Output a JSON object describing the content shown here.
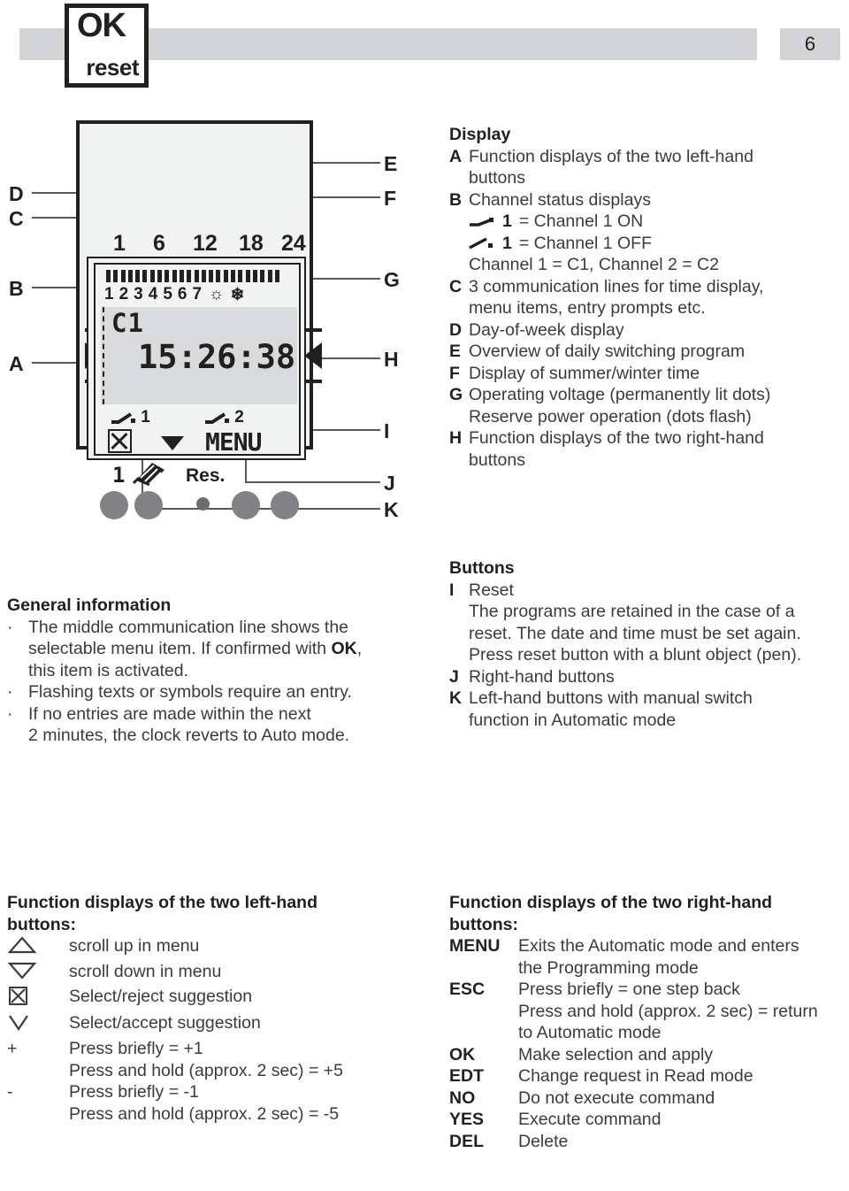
{
  "page": {
    "number": "6"
  },
  "header": {
    "button_box": {
      "ok_label": "OK",
      "reset_label": "reset"
    }
  },
  "device": {
    "hour_scale": [
      "1",
      "6",
      "12",
      "18",
      "24"
    ],
    "day_numbers": [
      "1",
      "2",
      "3",
      "4",
      "5",
      "6",
      "7"
    ],
    "summer_icon": "sun-icon",
    "winter_icon": "snowflake-icon",
    "lcd_line_top": "C1",
    "lcd_line_mid": "15:26:38",
    "channel_1_label": "1",
    "channel_2_label": "2",
    "lcd_menu_label": "MENU",
    "reset_label": "Res.",
    "manual_button_label": "1",
    "segment_count": 24,
    "callouts": [
      "A",
      "B",
      "C",
      "D",
      "E",
      "F",
      "G",
      "H",
      "I",
      "J",
      "K"
    ]
  },
  "display_legend": {
    "title": "Display",
    "items": [
      {
        "key": "A",
        "lines": [
          "Function displays of the two left-hand",
          "buttons"
        ]
      },
      {
        "key": "B",
        "lines": [
          "Channel status displays"
        ]
      },
      {
        "key": "C",
        "lines": [
          "3 communication lines for time display,",
          "menu items, entry prompts etc."
        ]
      },
      {
        "key": "D",
        "lines": [
          "Day-of-week display"
        ]
      },
      {
        "key": "E",
        "lines": [
          "Overview of daily switching program"
        ]
      },
      {
        "key": "F",
        "lines": [
          "Display of summer/winter time"
        ]
      },
      {
        "key": "G",
        "lines": [
          "Operating voltage (permanently lit dots)",
          "Reserve power operation (dots flash)"
        ]
      },
      {
        "key": "H",
        "lines": [
          "Function displays of the two right-hand",
          "buttons"
        ]
      }
    ],
    "channel_status": {
      "on_symbol": "switch-closed-icon",
      "on_channel": "1",
      "on_text": "= Channel 1 ON",
      "off_symbol": "switch-open-icon",
      "off_channel": "1",
      "off_text": "= Channel 1 OFF",
      "channel_names": "Channel 1 = C1, Channel 2 = C2"
    }
  },
  "general_information": {
    "title": "General information",
    "bullets": [
      {
        "lines": [
          "The middle communication line shows the",
          "selectable menu item. If confirmed with |OK|,",
          "this item is activated."
        ]
      },
      {
        "lines": [
          "Flashing texts or symbols require an entry."
        ]
      },
      {
        "lines": [
          "If no entries are made within the next",
          "2 minutes, the clock reverts to Auto mode."
        ]
      }
    ],
    "bullet_char": "·",
    "bold_token": "OK"
  },
  "buttons_legend": {
    "title": "Buttons",
    "items": [
      {
        "key": "I",
        "lines": [
          "Reset",
          "The programs are retained in the case of a",
          "reset. The date and time must be set again.",
          "Press reset button with a blunt object (pen)."
        ]
      },
      {
        "key": "J",
        "lines": [
          "Right-hand buttons"
        ]
      },
      {
        "key": "K",
        "lines": [
          "Left-hand buttons with manual switch",
          "function in Automatic mode"
        ]
      }
    ]
  },
  "left_functions": {
    "title_line1": "Function displays of the two left-hand",
    "title_line2": "buttons:",
    "rows": [
      {
        "glyph": "triangle-up-icon",
        "text": "scroll up in menu",
        "cont": []
      },
      {
        "glyph": "triangle-down-icon",
        "text": "scroll down in menu",
        "cont": []
      },
      {
        "glyph": "boxed-x-icon",
        "text": "Select/reject suggestion",
        "cont": []
      },
      {
        "glyph": "checkmark-icon",
        "text": "Select/accept suggestion",
        "cont": []
      },
      {
        "glyph": "plus-sign",
        "text": "Press briefly = +1",
        "cont": [
          "Press and hold (approx. 2 sec) = +5"
        ]
      },
      {
        "glyph": "minus-sign",
        "text": "Press briefly = -1",
        "cont": [
          "Press and hold (approx. 2 sec) = -5"
        ]
      }
    ],
    "plus_label": "+",
    "minus_label": "-"
  },
  "right_functions": {
    "title_line1": "Function displays of the two right-hand",
    "title_line2": "buttons:",
    "rows": [
      {
        "key": "MENU",
        "text": "Exits the Automatic mode and enters",
        "cont": [
          "the Programming mode"
        ]
      },
      {
        "key": "ESC",
        "text": "Press briefly = one step back",
        "cont": [
          "Press and hold (approx. 2 sec) = return",
          "to Automatic mode"
        ]
      },
      {
        "key": "OK",
        "text": "Make selection and apply",
        "cont": []
      },
      {
        "key": "EDT",
        "text": "Change request in Read mode",
        "cont": []
      },
      {
        "key": "NO",
        "text": "Do not execute command",
        "cont": []
      },
      {
        "key": "YES",
        "text": "Execute command",
        "cont": []
      },
      {
        "key": "DEL",
        "text": "Delete",
        "cont": []
      }
    ]
  },
  "colors": {
    "header_gray": "#d2d4d6",
    "device_body": "#f1f2f2",
    "lcd_screen": "#d9dadb",
    "button_gray": "#808285",
    "ink": "#231f20",
    "body_text": "#3b3b3b"
  }
}
